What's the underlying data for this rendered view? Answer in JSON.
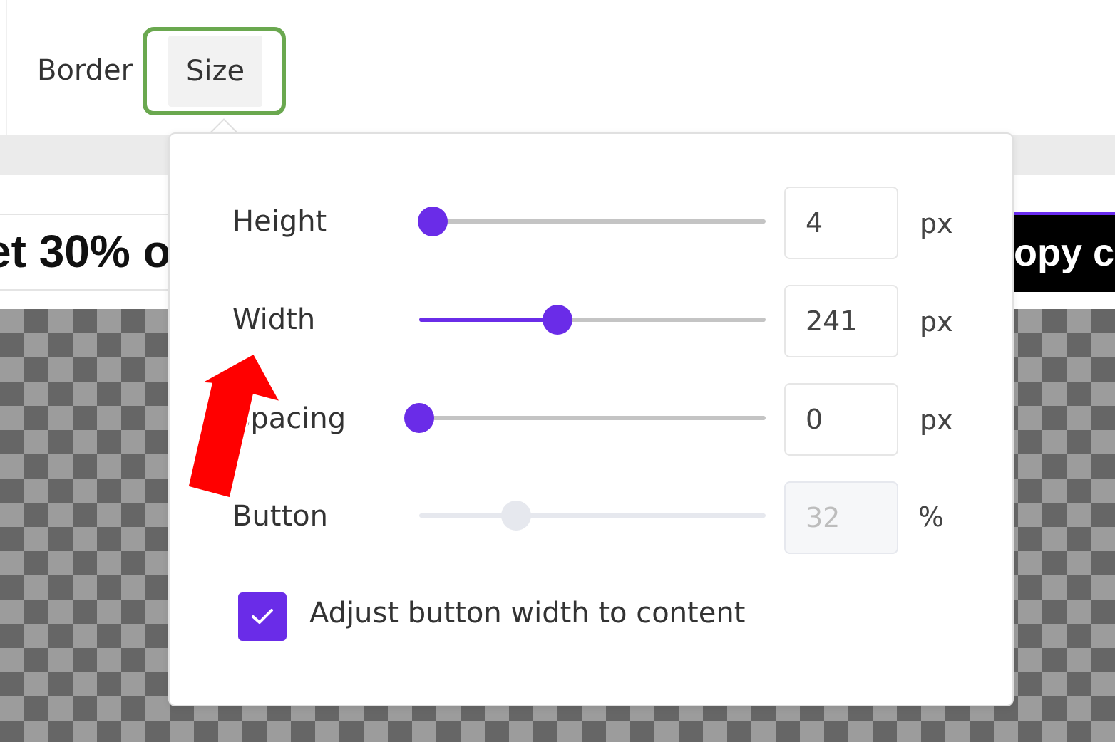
{
  "toolbar": {
    "tabs": [
      {
        "label": "Border"
      },
      {
        "label": "Size",
        "active": true
      }
    ]
  },
  "preview": {
    "promo_text": "et 30% o",
    "copy_button_text": "opy c"
  },
  "size_panel": {
    "rows": [
      {
        "label": "Height",
        "value": "4",
        "unit": "px",
        "slider_fraction": 0.04,
        "enabled": true
      },
      {
        "label": "Width",
        "value": "241",
        "unit": "px",
        "slider_fraction": 0.4,
        "enabled": true
      },
      {
        "label": "Spacing",
        "value": "0",
        "unit": "px",
        "slider_fraction": 0.0,
        "enabled": true
      },
      {
        "label": "Button",
        "value": "32",
        "unit": "%",
        "slider_fraction": 0.28,
        "enabled": false
      }
    ],
    "adjust_checkbox": {
      "label": "Adjust button width to content",
      "checked": true
    }
  },
  "colors": {
    "accent": "#6a2ce8",
    "highlight": "#6aa84f",
    "annotation_arrow": "#ff0000"
  }
}
